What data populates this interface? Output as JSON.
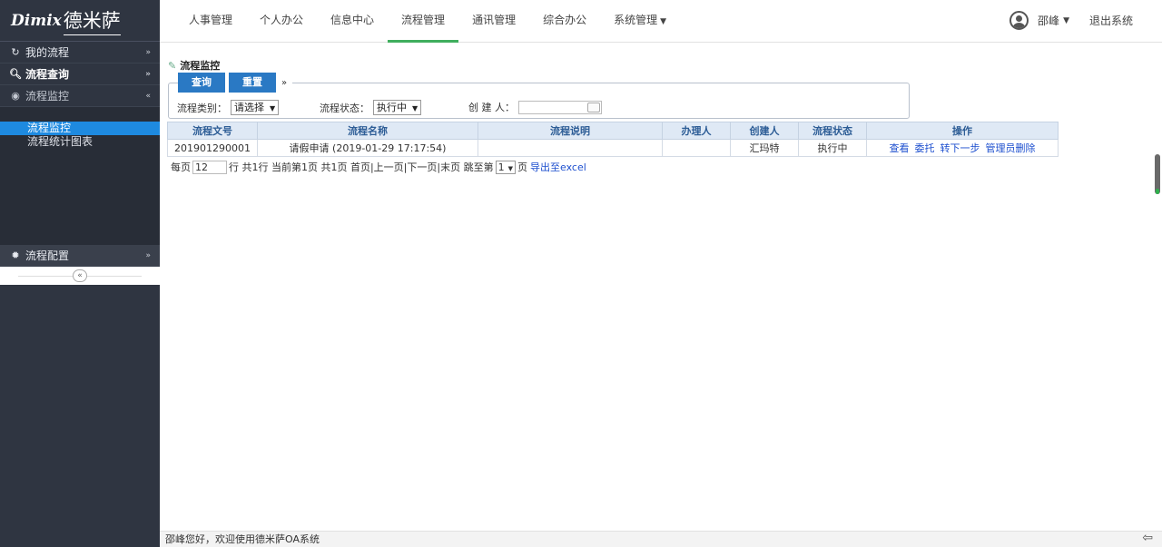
{
  "logo": {
    "brand_en": "Dimix",
    "brand_cn": "德米萨"
  },
  "sidebar": {
    "groups": [
      {
        "label": "我的流程",
        "icon": "refresh-icon",
        "chevron": "»"
      },
      {
        "label": "流程查询",
        "icon": "search-icon",
        "chevron": "»"
      },
      {
        "label": "流程监控",
        "icon": "eye-icon",
        "chevron": "«"
      }
    ],
    "subitems": [
      {
        "label": "流程监控",
        "active": true
      },
      {
        "label": "流程统计图表",
        "active": false
      }
    ],
    "config": {
      "label": "流程配置",
      "icon": "gear-icon",
      "chevron": "»"
    },
    "collapse_symbol": "«"
  },
  "topnav": {
    "items": [
      {
        "label": "人事管理",
        "active": false
      },
      {
        "label": "个人办公",
        "active": false
      },
      {
        "label": "信息中心",
        "active": false
      },
      {
        "label": "流程管理",
        "active": true
      },
      {
        "label": "通讯管理",
        "active": false
      },
      {
        "label": "综合办公",
        "active": false
      },
      {
        "label": "系统管理",
        "active": false,
        "has_dropdown": true
      }
    ],
    "user": "邵峰",
    "logout": "退出系统"
  },
  "panel": {
    "title": "流程监控",
    "buttons": {
      "query": "查询",
      "reset": "重置"
    },
    "filters": {
      "category_label": "流程类别：",
      "category_value": "请选择",
      "status_label": "流程状态：",
      "status_value": "执行中",
      "creator_label": "创 建 人："
    }
  },
  "grid": {
    "headers": [
      "流程文号",
      "流程名称",
      "流程说明",
      "办理人",
      "创建人",
      "流程状态",
      "操作"
    ],
    "rows": [
      {
        "doc_no": "201901290001",
        "name": "请假申请 (2019-01-29 17:17:54)",
        "desc": "",
        "handler": "",
        "creator": "汇玛特",
        "status": "执行中",
        "actions": [
          "查看",
          "委托",
          "转下一步",
          "管理员删除"
        ]
      }
    ]
  },
  "pager": {
    "per_page_label": "每页",
    "per_page_value": "12",
    "summary": "行 共1行  当前第1页  共1页  首页|上一页|下一页|末页  跳至第",
    "jump_value": "1",
    "page_suffix": "页",
    "export_label": "导出至excel"
  },
  "statusbar": {
    "text": "邵峰您好，欢迎使用德米萨OA系统"
  }
}
